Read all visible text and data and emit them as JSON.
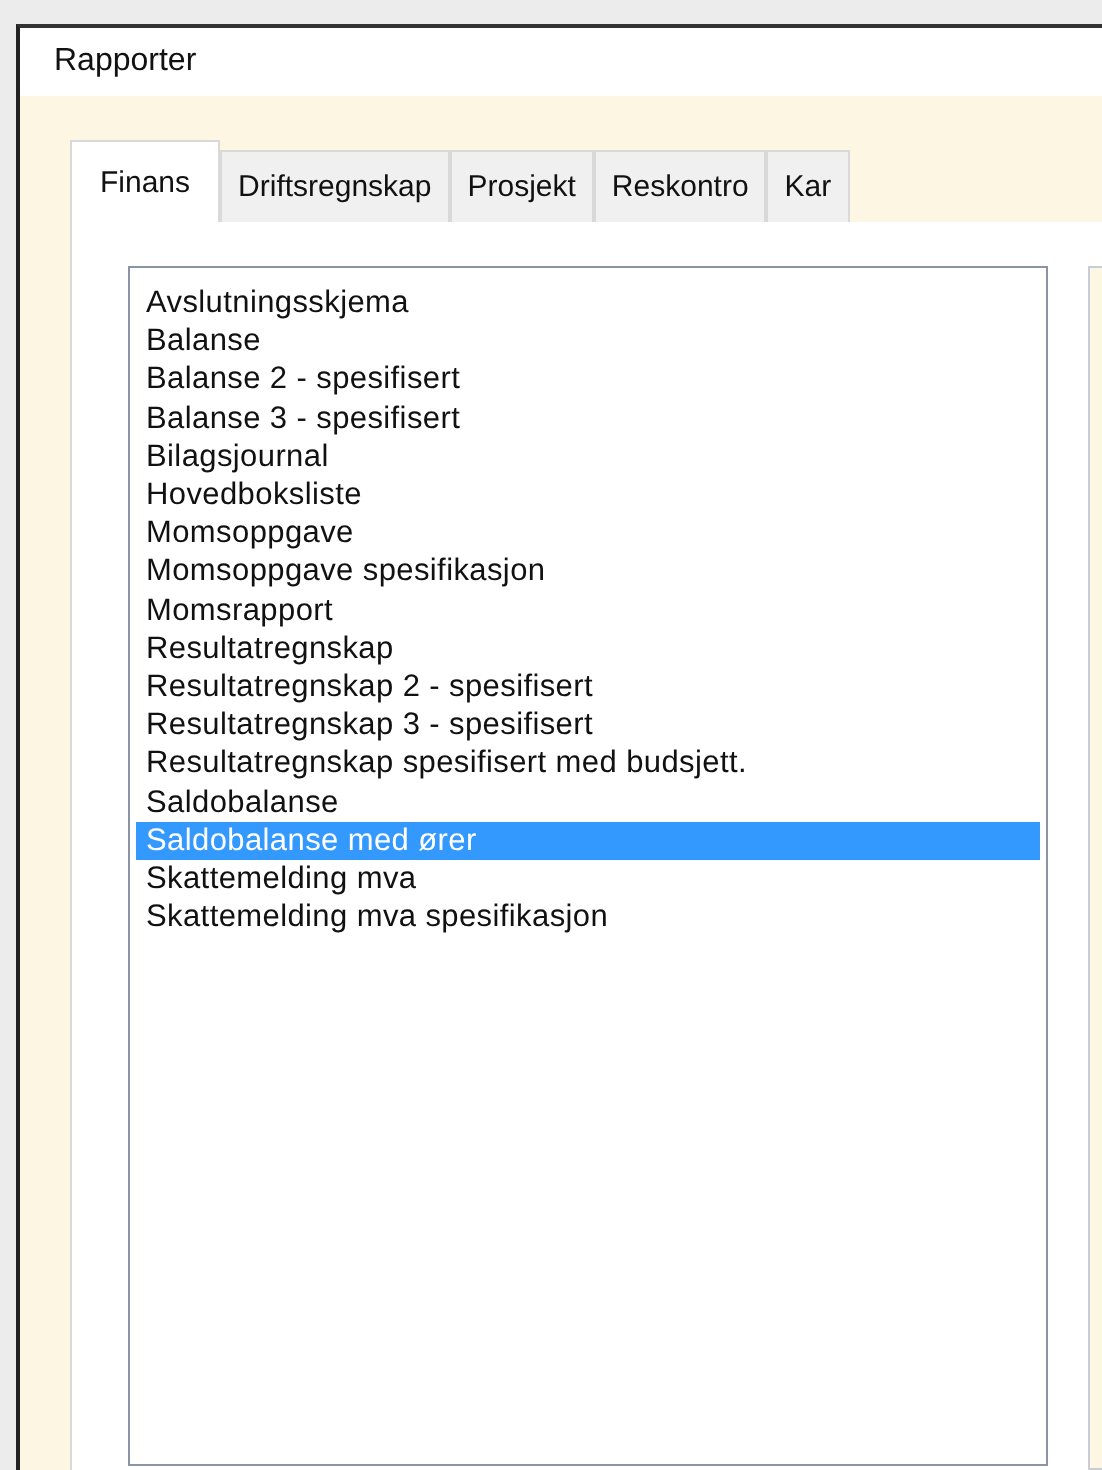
{
  "window": {
    "title": "Rapporter"
  },
  "tabs": [
    {
      "label": "Finans",
      "selected": true
    },
    {
      "label": "Driftsregnskap",
      "selected": false
    },
    {
      "label": "Prosjekt",
      "selected": false
    },
    {
      "label": "Reskontro",
      "selected": false
    },
    {
      "label": "Kar",
      "selected": false
    }
  ],
  "reports": [
    {
      "label": "Avslutningsskjema",
      "selected": false
    },
    {
      "label": "Balanse",
      "selected": false
    },
    {
      "label": "Balanse 2 - spesifisert",
      "selected": false
    },
    {
      "label": "Balanse 3 - spesifisert",
      "selected": false
    },
    {
      "label": "Bilagsjournal",
      "selected": false
    },
    {
      "label": "Hovedboksliste",
      "selected": false
    },
    {
      "label": "Momsoppgave",
      "selected": false
    },
    {
      "label": "Momsoppgave spesifikasjon",
      "selected": false
    },
    {
      "label": "Momsrapport",
      "selected": false
    },
    {
      "label": "Resultatregnskap",
      "selected": false
    },
    {
      "label": "Resultatregnskap 2 - spesifisert",
      "selected": false
    },
    {
      "label": "Resultatregnskap 3 - spesifisert",
      "selected": false
    },
    {
      "label": "Resultatregnskap spesifisert med budsjett.",
      "selected": false
    },
    {
      "label": "Saldobalanse",
      "selected": false
    },
    {
      "label": "Saldobalanse med ører",
      "selected": true
    },
    {
      "label": "Skattemelding mva",
      "selected": false
    },
    {
      "label": "Skattemelding mva spesifikasjon",
      "selected": false
    }
  ]
}
